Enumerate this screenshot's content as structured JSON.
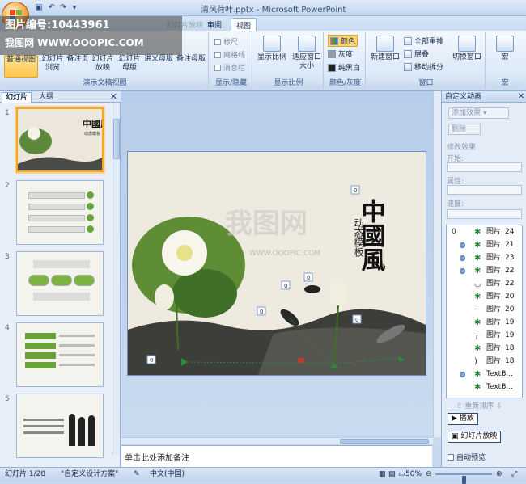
{
  "window": {
    "title": "清风荷叶.pptx - Microsoft PowerPoint"
  },
  "watermark": {
    "line1": "图片编号:10443961",
    "line2": "我图网  WWW.OOOPIC.COM",
    "slide_mark": "我图网",
    "slide_url": "WWW.OOOPIC.COM"
  },
  "tabs": [
    {
      "label": "审阅"
    },
    {
      "label": "视图"
    }
  ],
  "ribbon_partial_tab": "幻灯片放映",
  "ribbon": {
    "presentation_views": {
      "label": "演示文稿视图",
      "normal": "普通视图",
      "sorter": "幻灯片浏览",
      "notes": "备注页",
      "slideshow": "幻灯片放映",
      "slide_master": "幻灯片母版",
      "handout_master": "讲义母版",
      "notes_master": "备注母版"
    },
    "show_hide": {
      "label": "显示/隐藏",
      "ruler": "标尺",
      "gridlines": "网格线",
      "message_bar": "消息栏"
    },
    "zoom": {
      "label": "显示比例",
      "zoom": "显示比例",
      "fit": "适应窗口大小"
    },
    "color": {
      "label": "颜色/灰度",
      "color": "颜色",
      "grayscale": "灰度",
      "bw": "纯黑白"
    },
    "window": {
      "label": "窗口",
      "new": "新建窗口",
      "arrange": "全部重排",
      "cascade": "层叠",
      "move_split": "移动拆分",
      "switch": "切换窗口"
    },
    "macros": {
      "label": "宏",
      "macro": "宏"
    }
  },
  "left_pane": {
    "tabs": [
      "幻灯片",
      "大纲"
    ],
    "slides": [
      {
        "num": "1",
        "title": "中國風",
        "subtitle": "动态模板"
      },
      {
        "num": "2",
        "items": [
          "",
          "",
          "",
          ""
        ]
      },
      {
        "num": "3"
      },
      {
        "num": "4"
      },
      {
        "num": "5"
      }
    ]
  },
  "slide": {
    "title": "中國風",
    "subtitle": "动态模板",
    "markers": [
      "0",
      "0",
      "0",
      "0",
      "0",
      "0"
    ]
  },
  "notes_placeholder": "单击此处添加备注",
  "task_pane": {
    "title": "自定义动画",
    "add_effect": "添加效果",
    "remove": "删除",
    "modify_label": "修改效果",
    "start_label": "开始:",
    "property_label": "属性:",
    "speed_label": "速度:",
    "animations": [
      {
        "num": "0",
        "dot": false,
        "icon": "star",
        "label": "图片",
        "n": "24"
      },
      {
        "num": "",
        "dot": true,
        "icon": "star",
        "label": "图片",
        "n": "21"
      },
      {
        "num": "",
        "dot": true,
        "icon": "star",
        "label": "图片",
        "n": "23"
      },
      {
        "num": "",
        "dot": true,
        "icon": "star",
        "label": "图片",
        "n": "22"
      },
      {
        "num": "",
        "dot": false,
        "icon": "curve",
        "label": "图片",
        "n": "22"
      },
      {
        "num": "",
        "dot": false,
        "icon": "star",
        "label": "图片",
        "n": "20"
      },
      {
        "num": "",
        "dot": false,
        "icon": "line",
        "label": "图片",
        "n": "20"
      },
      {
        "num": "",
        "dot": false,
        "icon": "star",
        "label": "图片",
        "n": "19"
      },
      {
        "num": "",
        "dot": false,
        "icon": "corner",
        "label": "图片",
        "n": "19"
      },
      {
        "num": "",
        "dot": false,
        "icon": "star",
        "label": "图片",
        "n": "18"
      },
      {
        "num": "",
        "dot": false,
        "icon": "arc",
        "label": "图片",
        "n": "18"
      },
      {
        "num": "",
        "dot": true,
        "icon": "star",
        "label": "TextB...",
        "n": ""
      },
      {
        "num": "",
        "dot": false,
        "icon": "star",
        "label": "TextB...",
        "n": ""
      }
    ],
    "reorder": "重新排序",
    "play": "播放",
    "slideshow": "幻灯片放映",
    "autopreview": "自动预览"
  },
  "status": {
    "slide": "幻灯片 1/28",
    "theme": "\"自定义设计方案\"",
    "language": "中文(中国)",
    "zoom": "50%"
  },
  "zoom_level": 0.5
}
